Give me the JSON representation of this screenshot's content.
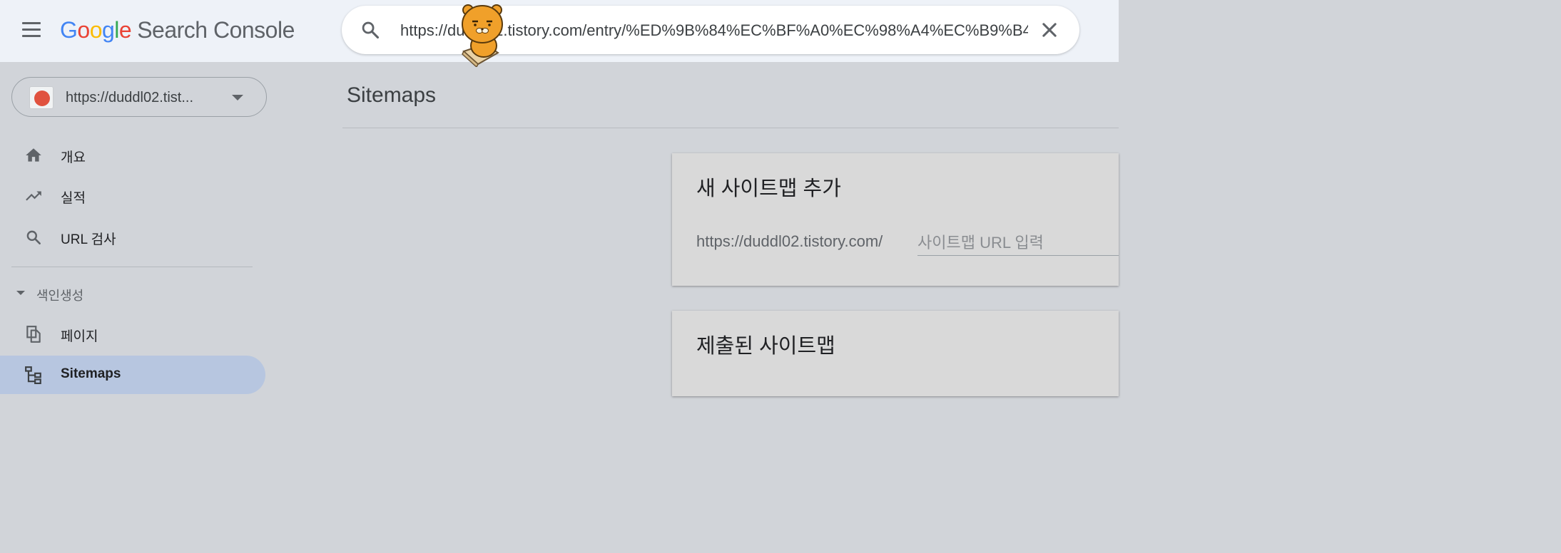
{
  "topbar": {
    "menu_icon": "hamburger-menu-icon",
    "logo": {
      "letters": [
        "G",
        "o",
        "o",
        "g",
        "l",
        "e"
      ],
      "product": "Search Console"
    },
    "search": {
      "value": "https://duddl02.tistory.com/entry/%ED%9B%84%EC%BF%A0%EC%98%A4%EC%B9%B4",
      "search_icon": "search-icon",
      "clear_icon": "close-icon"
    }
  },
  "sidebar": {
    "property": {
      "label": "https://duddl02.tist...",
      "icon": "tistory-favicon-icon",
      "caret_icon": "dropdown-caret-icon"
    },
    "nav": [
      {
        "label": "개요",
        "icon": "home-icon"
      },
      {
        "label": "실적",
        "icon": "trending-up-icon"
      },
      {
        "label": "URL 검사",
        "icon": "search-icon"
      }
    ],
    "section": {
      "label": "색인생성",
      "caret_icon": "collapse-caret-icon"
    },
    "index_items": [
      {
        "label": "페이지",
        "icon": "pages-icon"
      },
      {
        "label": "Sitemaps",
        "icon": "sitemap-icon",
        "active": true
      }
    ]
  },
  "main": {
    "title": "Sitemaps",
    "add_card": {
      "title": "새 사이트맵 추가",
      "url_prefix": "https://duddl02.tistory.com/",
      "input_placeholder": "사이트맵 URL 입력"
    },
    "submitted_card": {
      "title": "제출된 사이트맵"
    }
  },
  "colors": {
    "topbar_bg": "#eef2f8",
    "page_bg": "#d1d4d9",
    "active_nav_bg": "#b7c6e0",
    "card_bg": "#d9d9d9",
    "google_blue": "#4285f4",
    "google_red": "#ea4335",
    "google_yellow": "#fbbc05",
    "google_green": "#34a853"
  }
}
